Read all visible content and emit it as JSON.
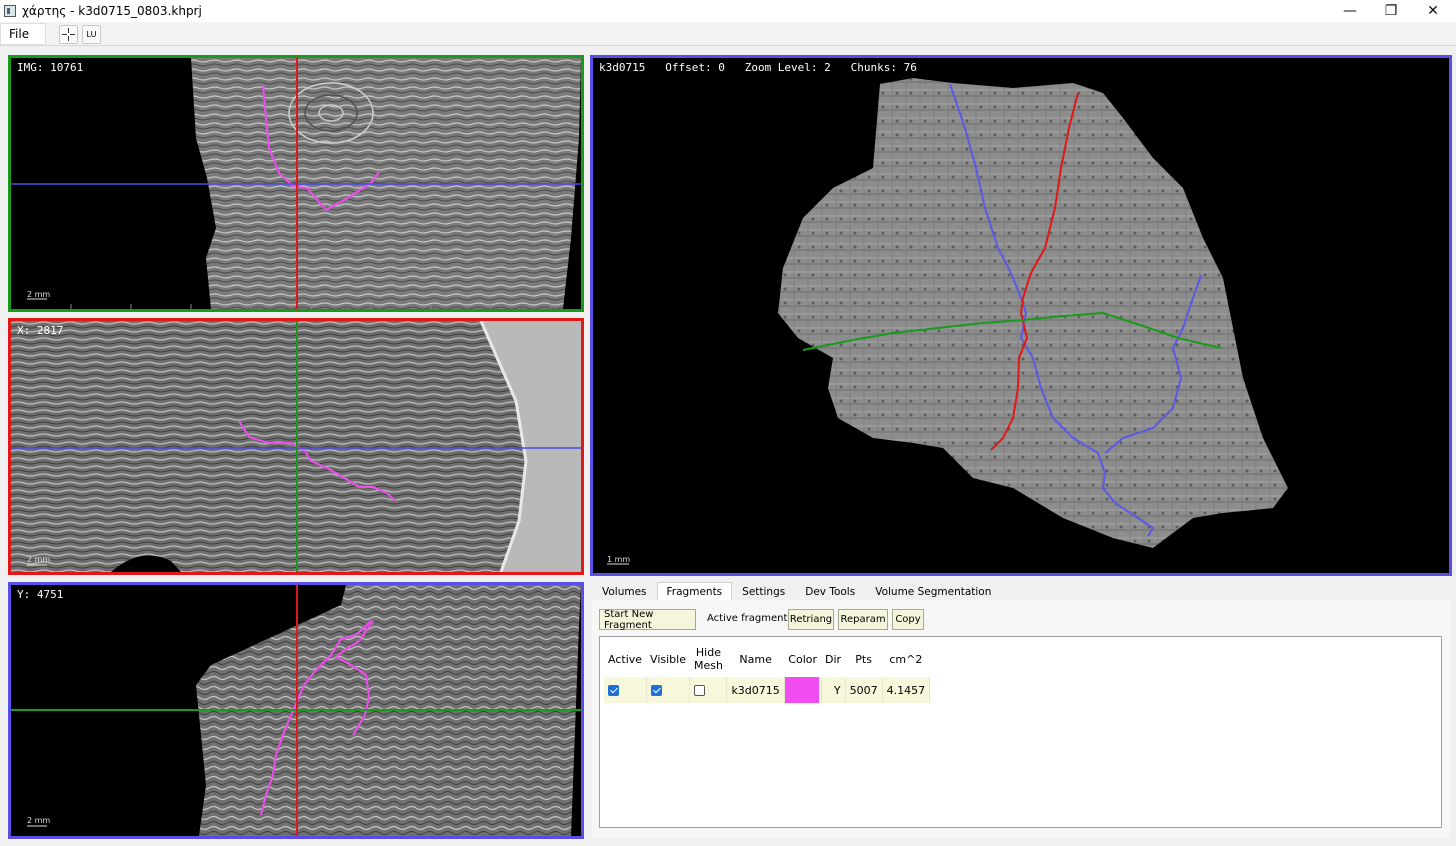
{
  "window": {
    "title": "χάρτης - k3d0715_0803.khprj",
    "controls": {
      "minimize": "—",
      "maximize": "❐",
      "close": "✕"
    }
  },
  "menu": {
    "file": "File"
  },
  "toolbar": {
    "crosshair_icon": "crosshair-icon",
    "lu_label": "LU"
  },
  "views": {
    "img": {
      "label": "IMG: 10761",
      "scale": "2 mm",
      "border": "#1a9a1a"
    },
    "x": {
      "label": "X: 2817",
      "scale": "2 mm",
      "border": "#e01818"
    },
    "y": {
      "label": "Y: 4751",
      "scale": "2 mm",
      "border": "#5a4ee6"
    },
    "fragment": {
      "label": "k3d0715   Offset: 0   Zoom Level: 2   Chunks: 76",
      "scale": "1 mm",
      "border": "#5a4ee6"
    }
  },
  "tabs": [
    "Volumes",
    "Fragments",
    "Settings",
    "Dev Tools",
    "Volume Segmentation"
  ],
  "active_tab": "Fragments",
  "fragments_panel": {
    "start_button": "Start New Fragment",
    "active_fragment_label": "Active fragment:",
    "retriang_button": "Retriang",
    "reparam_button": "Reparam",
    "copy_button": "Copy"
  },
  "table": {
    "headers": [
      "Active",
      "Visible",
      "Hide Mesh",
      "Name",
      "Color",
      "Dir",
      "Pts",
      "cm^2"
    ],
    "rows": [
      {
        "active": true,
        "visible": true,
        "hide_mesh": false,
        "name": "k3d0715",
        "color": "#f04cf0",
        "dir": "Y",
        "pts": "5007",
        "area": "4.1457"
      }
    ]
  }
}
